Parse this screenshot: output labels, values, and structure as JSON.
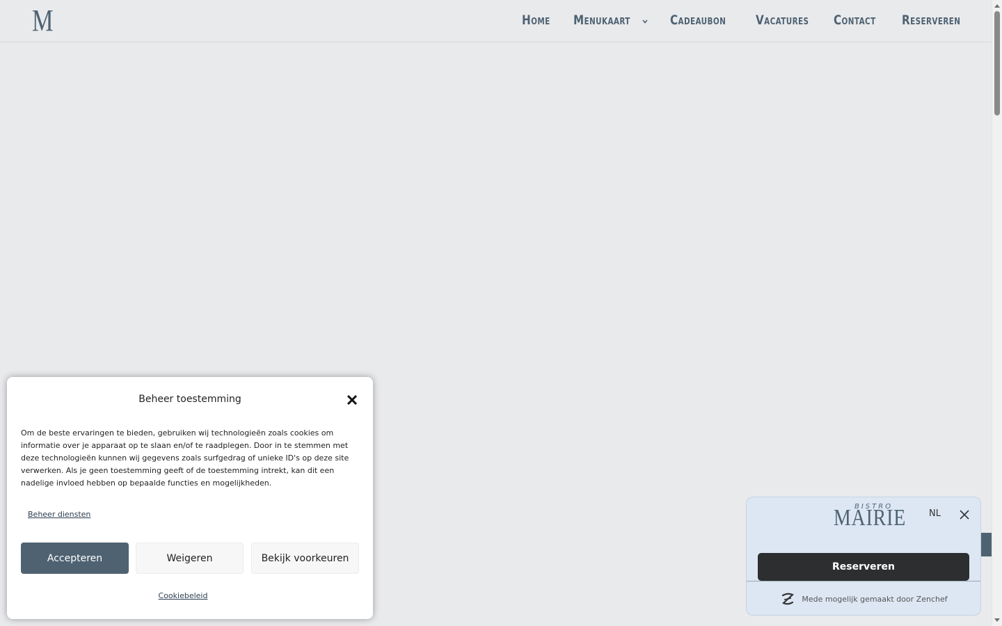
{
  "header": {
    "logo": "M",
    "nav": [
      {
        "label": "Home"
      },
      {
        "label": "Menukaart"
      },
      {
        "label": "Cadeaubon"
      },
      {
        "label": "Vacatures"
      },
      {
        "label": "Contact"
      },
      {
        "label": "Reserveren"
      }
    ]
  },
  "cookie": {
    "title": "Beheer toestemming",
    "text": "Om de beste ervaringen te bieden, gebruiken wij technologieën zoals cookies om informatie over je apparaat op te slaan en/of te raadplegen. Door in te stemmen met deze technologieën kunnen wij gegevens zoals surfgedrag of unieke ID's op deze site verwerken. Als je geen toestemming geeft of de toestemming intrekt, kan dit een nadelige invloed hebben op bepaalde functies en mogelijkheden.",
    "manage_services": "Beheer diensten",
    "accept": "Accepteren",
    "deny": "Weigeren",
    "preferences": "Bekijk voorkeuren",
    "policy": "Cookiebeleid"
  },
  "widget": {
    "logo_small": "BISTRO",
    "logo_big": "MAIRIE",
    "language": "NL",
    "reserve": "Reserveren",
    "footer": "Mede mogelijk gemaakt door Zenchef"
  },
  "colors": {
    "brand": "#4e6272",
    "background": "#e9eaec",
    "widget_bg": "#dde7f3",
    "widget_button": "#2c2e30"
  },
  "icons": {
    "nav_dropdown": "chevron-down-icon",
    "cookie_close": "close-icon",
    "widget_close": "close-icon",
    "footer": "zenchef-icon"
  }
}
